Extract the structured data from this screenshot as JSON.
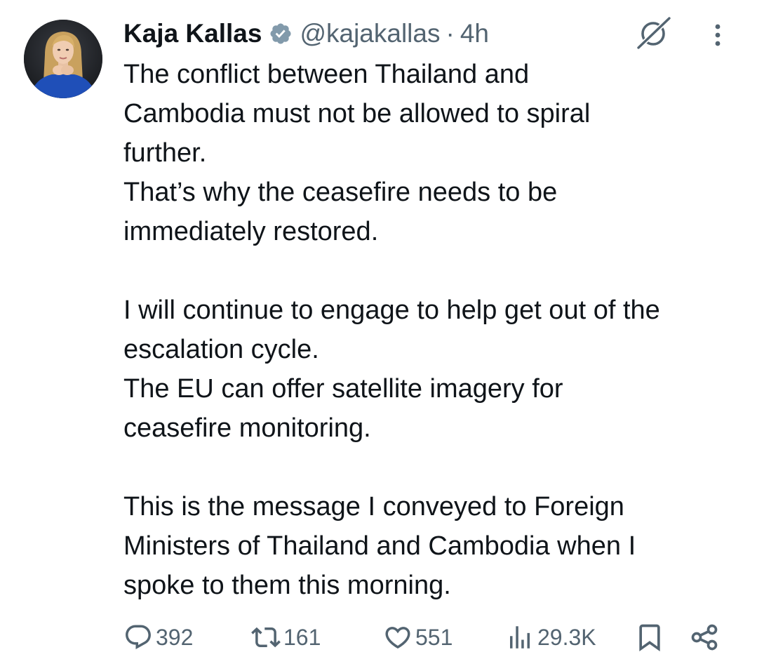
{
  "tweet": {
    "author": {
      "name": "Kaja Kallas",
      "handle": "@kajakallas",
      "verified": true,
      "avatar_icon": "profile-photo"
    },
    "separator": "·",
    "time": "4h",
    "text_lines": [
      "The conflict between Thailand and",
      "Cambodia must not be allowed to spiral",
      "further.",
      "That’s why the ceasefire needs to be",
      "immediately restored.",
      "",
      "I will continue to engage to help get out of the",
      "escalation cycle.",
      "The EU can offer satellite imagery for",
      "ceasefire monitoring.",
      "",
      "This is the message I conveyed to Foreign",
      "Ministers of Thailand and Cambodia when I",
      "spoke to them this morning."
    ],
    "actions": {
      "replies": "392",
      "reposts": "161",
      "likes": "551",
      "views": "29.3K"
    }
  },
  "colors": {
    "text": "#0f1419",
    "secondary": "#536471",
    "verified_badge": "#829aab"
  }
}
